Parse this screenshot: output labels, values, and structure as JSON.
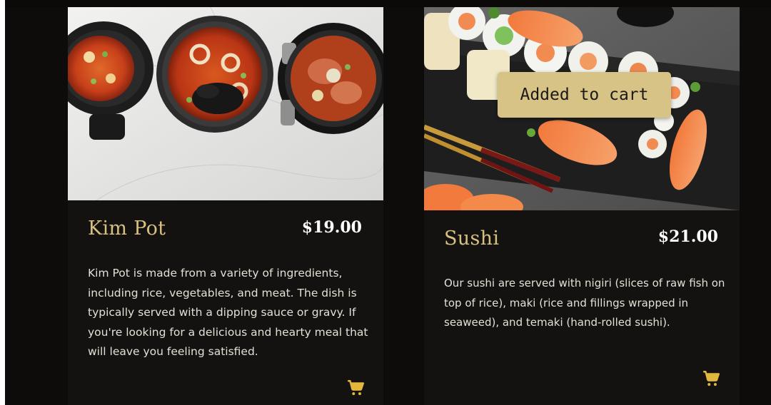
{
  "colors": {
    "background": "#0d0c0a",
    "card_bg": "#131210",
    "title_gold": "#d8c07f",
    "price_white": "#ffffff",
    "toast_bg": "#d8c387",
    "cart_icon": "#e2b83c"
  },
  "cards": [
    {
      "title": "Kim Pot",
      "price": "$19.00",
      "description": "Kim Pot is made from a variety of ingredients, including rice, vegetables, and meat. The dish is typically served with a dipping sauce or gravy. If you're looking for a delicious and hearty meal that will leave you feeling satisfied.",
      "image": "korean-stew-bowls-photo",
      "cart_icon": "cart-icon"
    },
    {
      "title": "Sushi",
      "price": "$21.00",
      "description": "Our sushi are served with nigiri (slices of raw fish on top of rice), maki (rice and fillings wrapped in seaweed), and temaki (hand-rolled sushi).",
      "image": "sushi-platter-photo",
      "cart_icon": "cart-icon"
    }
  ],
  "toast": {
    "message": "Added to cart"
  }
}
